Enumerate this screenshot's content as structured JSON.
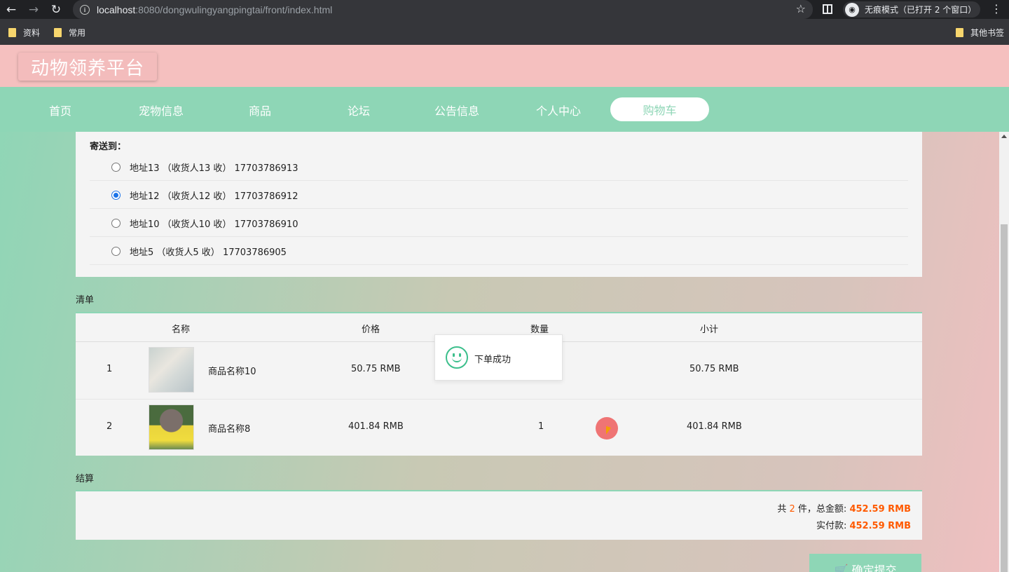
{
  "browser": {
    "url_host": "localhost",
    "url_path": ":8080/dongwulingyangpingtai/front/index.html",
    "incognito_label": "无痕模式（已打开 2 个窗口）",
    "bookmarks": [
      "资料",
      "常用"
    ],
    "other_bookmarks": "其他书签"
  },
  "site": {
    "logo": "动物领养平台",
    "nav": [
      "首页",
      "宠物信息",
      "商品",
      "论坛",
      "公告信息",
      "个人中心"
    ],
    "nav_active": "购物车"
  },
  "address": {
    "title": "寄送到：",
    "options": [
      {
        "text": "地址13 （收货人13 收） 17703786913",
        "selected": false
      },
      {
        "text": "地址12 （收货人12 收） 17703786912",
        "selected": true
      },
      {
        "text": "地址10 （收货人10 收） 17703786910",
        "selected": false
      },
      {
        "text": "地址5 （收货人5 收） 17703786905",
        "selected": false
      }
    ]
  },
  "list": {
    "label": "清单",
    "headers": [
      "名称",
      "价格",
      "数量",
      "小计"
    ],
    "rows": [
      {
        "index": "1",
        "name": "商品名称10",
        "price": "50.75 RMB",
        "qty": "",
        "subtotal": "50.75 RMB"
      },
      {
        "index": "2",
        "name": "商品名称8",
        "price": "401.84 RMB",
        "qty": "1",
        "subtotal": "401.84 RMB"
      }
    ]
  },
  "toast": {
    "message": "下单成功"
  },
  "settle": {
    "label": "结算",
    "prefix": "共 ",
    "count": "2",
    "mid": " 件，总金额: ",
    "total": "452.59 RMB",
    "paid_label": "实付款: ",
    "paid": "452.59 RMB"
  },
  "submit": {
    "label": "🛒 确定提交"
  },
  "colors": {
    "accent": "#8ed6b6",
    "header": "#f5c0bf",
    "price": "#ff5a00"
  }
}
